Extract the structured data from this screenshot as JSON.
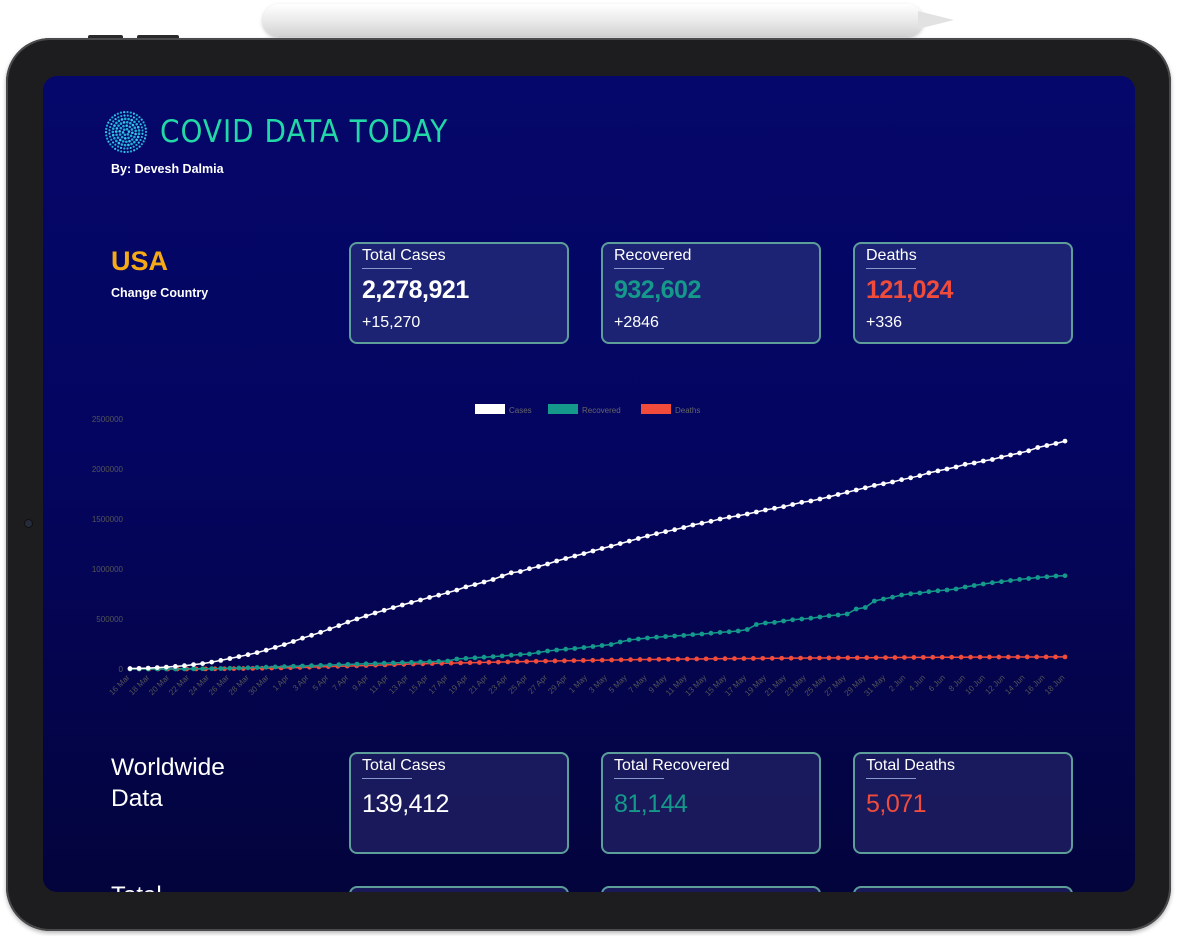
{
  "app": {
    "title": "COVID DATA TODAY",
    "byline": "By: Devesh Dalmia"
  },
  "country": {
    "name": "USA",
    "change_label": "Change Country"
  },
  "country_stats": [
    {
      "label": "Total Cases",
      "value": "2,278,921",
      "delta": "+15,270",
      "color": "#ffffff"
    },
    {
      "label": "Recovered",
      "value": "932,602",
      "delta": "+2846",
      "color": "#14998a"
    },
    {
      "label": "Deaths",
      "value": "121,024",
      "delta": "+336",
      "color": "#f04b3b"
    }
  ],
  "worldwide": {
    "title_line1": "Worldwide",
    "title_line2": "Data",
    "stats": [
      {
        "label": "Total Cases",
        "value": "139,412",
        "color": "#ffffff"
      },
      {
        "label": "Total Recovered",
        "value": "81,144",
        "color": "#14998a"
      },
      {
        "label": "Total Deaths",
        "value": "5,071",
        "color": "#f04b3b"
      }
    ]
  },
  "next_section_title": "Total",
  "colors": {
    "brand": "#21d8a6",
    "country": "#f5a915",
    "cases": "#ffffff",
    "recovered": "#14998a",
    "deaths": "#f04b3b",
    "card_border": "#5e9e9a"
  },
  "chart_data": {
    "type": "line",
    "legend_position": "top-center",
    "grid": false,
    "ylim": [
      0,
      2500000
    ],
    "y_ticks": [
      0,
      500000,
      1000000,
      1500000,
      2000000,
      2500000
    ],
    "x_labels": [
      "16 Mar",
      "18 Mar",
      "20 Mar",
      "22 Mar",
      "24 Mar",
      "26 Mar",
      "28 Mar",
      "30 Mar",
      "1 Apr",
      "3 Apr",
      "5 Apr",
      "7 Apr",
      "9 Apr",
      "11 Apr",
      "13 Apr",
      "15 Apr",
      "17 Apr",
      "19 Apr",
      "21 Apr",
      "23 Apr",
      "25 Apr",
      "27 Apr",
      "29 Apr",
      "1 May",
      "3 May",
      "5 May",
      "7 May",
      "9 May",
      "11 May",
      "13 May",
      "15 May",
      "17 May",
      "19 May",
      "21 May",
      "23 May",
      "25 May",
      "27 May",
      "29 May",
      "31 May",
      "2 Jun",
      "4 Jun",
      "6 Jun",
      "8 Jun",
      "10 Jun",
      "12 Jun",
      "14 Jun",
      "16 Jun",
      "18 Jun"
    ],
    "series": [
      {
        "name": "Cases",
        "color": "#ffffff",
        "values": [
          4600,
          6300,
          9000,
          14000,
          19000,
          26000,
          33000,
          44000,
          54000,
          69000,
          86000,
          105000,
          124000,
          143000,
          164000,
          188000,
          216000,
          244000,
          275000,
          308000,
          337000,
          367000,
          401000,
          433000,
          469000,
          500000,
          530000,
          560000,
          587000,
          614000,
          640000,
          666000,
          690000,
          716000,
          738000,
          763000,
          789000,
          821000,
          844000,
          870000,
          895000,
          930000,
          962000,
          975000,
          1003000,
          1025000,
          1050000,
          1080000,
          1105000,
          1130000,
          1154000,
          1180000,
          1205000,
          1229000,
          1254000,
          1279000,
          1305000,
          1330000,
          1353000,
          1373000,
          1393000,
          1415000,
          1440000,
          1458000,
          1477000,
          1500000,
          1518000,
          1532000,
          1550000,
          1570000,
          1590000,
          1607000,
          1623000,
          1645000,
          1667000,
          1680000,
          1700000,
          1721000,
          1745000,
          1767000,
          1790000,
          1812000,
          1836000,
          1852000,
          1870000,
          1893000,
          1912000,
          1933000,
          1961000,
          1981000,
          2000000,
          2020000,
          2047000,
          2060000,
          2080000,
          2095000,
          2120000,
          2140000,
          2160000,
          2182000,
          2215000,
          2235000,
          2255000,
          2278921
        ]
      },
      {
        "name": "Recovered",
        "color": "#14998a",
        "values": [
          100,
          150,
          200,
          300,
          400,
          700,
          900,
          1500,
          2200,
          3300,
          5000,
          7000,
          9700,
          12000,
          15000,
          18000,
          21000,
          24000,
          27000,
          30000,
          33000,
          36000,
          40000,
          43000,
          46000,
          49000,
          52000,
          55000,
          58000,
          61000,
          64000,
          66000,
          70000,
          73000,
          76000,
          80000,
          100000,
          106000,
          112000,
          118000,
          124000,
          130000,
          138000,
          145000,
          150000,
          165000,
          180000,
          190000,
          198000,
          205000,
          215000,
          225000,
          235000,
          245000,
          270000,
          290000,
          300000,
          310000,
          318000,
          325000,
          330000,
          336000,
          344000,
          350000,
          358000,
          366000,
          372000,
          380000,
          395000,
          445000,
          460000,
          466000,
          480000,
          492000,
          500000,
          508000,
          520000,
          532000,
          540000,
          550000,
          600000,
          615000,
          680000,
          700000,
          718000,
          740000,
          752000,
          760000,
          773000,
          782000,
          790000,
          800000,
          820000,
          835000,
          850000,
          863000,
          873000,
          885000,
          896000,
          905000,
          915000,
          922000,
          930000,
          932602
        ]
      },
      {
        "name": "Deaths",
        "color": "#f04b3b",
        "values": [
          90,
          120,
          160,
          240,
          320,
          440,
          600,
          900,
          1300,
          1800,
          2500,
          3400,
          4500,
          5900,
          7400,
          9000,
          11000,
          13000,
          15500,
          18000,
          21000,
          24000,
          27000,
          29000,
          32000,
          35000,
          38000,
          41000,
          44000,
          47000,
          50000,
          52000,
          55000,
          57000,
          59000,
          61000,
          63000,
          65000,
          67000,
          69000,
          71000,
          73000,
          75000,
          77000,
          79000,
          80500,
          82000,
          84000,
          85500,
          87000,
          88500,
          90000,
          91500,
          93000,
          94500,
          95500,
          96500,
          97500,
          98500,
          99500,
          100500,
          101500,
          102400,
          103300,
          104000,
          104800,
          105600,
          106400,
          107000,
          107700,
          108300,
          109000,
          109600,
          110200,
          110800,
          111400,
          112000,
          112500,
          113100,
          113600,
          114100,
          114700,
          115200,
          115700,
          116200,
          116700,
          117200,
          117700,
          118100,
          118500,
          118900,
          119300,
          119600,
          119900,
          120200,
          120400,
          120600,
          120800,
          121000,
          121024
        ]
      }
    ]
  }
}
